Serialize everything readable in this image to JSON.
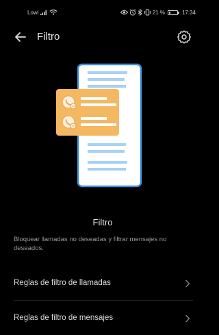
{
  "status_bar": {
    "carrier": "Lowi",
    "battery_percent": "21 %",
    "battery_level": 0.21,
    "time": "17:34",
    "icons": [
      "signal-icon",
      "wifi-icon",
      "eye-icon",
      "alarm-icon",
      "bluetooth-icon",
      "vibrate-icon",
      "battery-icon"
    ]
  },
  "app_bar": {
    "title": "Filtro",
    "back_icon": "arrow-left-icon",
    "settings_icon": "gear-icon"
  },
  "feature": {
    "title": "Filtro",
    "description": "Bloquear llamadas no deseadas y filtrar mensajes no deseados."
  },
  "menu": {
    "items": [
      {
        "label": "Reglas de filtro de llamadas",
        "icon": "chevron-right-icon"
      },
      {
        "label": "Reglas de filtro de mensajes",
        "icon": "chevron-right-icon"
      }
    ]
  },
  "colors": {
    "background": "#000000",
    "illustration_phone_border": "#3a8fe0",
    "illustration_phone_fill": "#ffffff",
    "illustration_lines": "#a9d1f5",
    "illustration_card": "#f4b862"
  }
}
